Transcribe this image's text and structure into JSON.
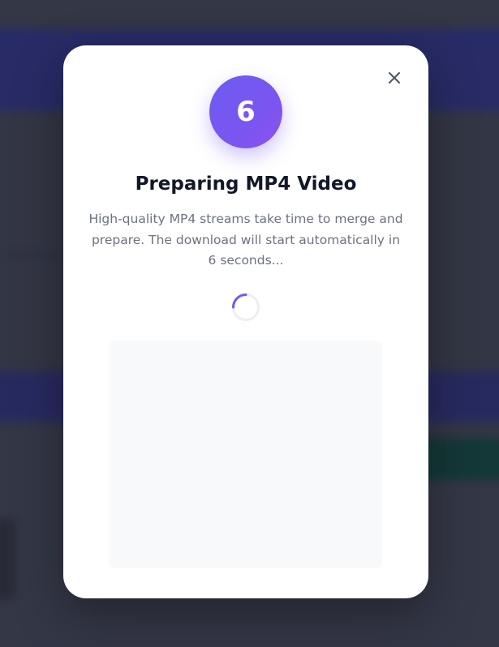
{
  "modal": {
    "countdown": "6",
    "title": "Preparing MP4 Video",
    "description": "High-quality MP4 streams take time to merge and prepare. The download will start automatically in 6 seconds...",
    "close_icon": "close-icon",
    "spinner_icon": "loading-spinner-icon"
  },
  "colors": {
    "accent": "#6d5cf2",
    "title": "#111827",
    "text_muted": "#6b7280",
    "modal_bg": "#ffffff",
    "placeholder_bg": "#f8f9fb"
  }
}
